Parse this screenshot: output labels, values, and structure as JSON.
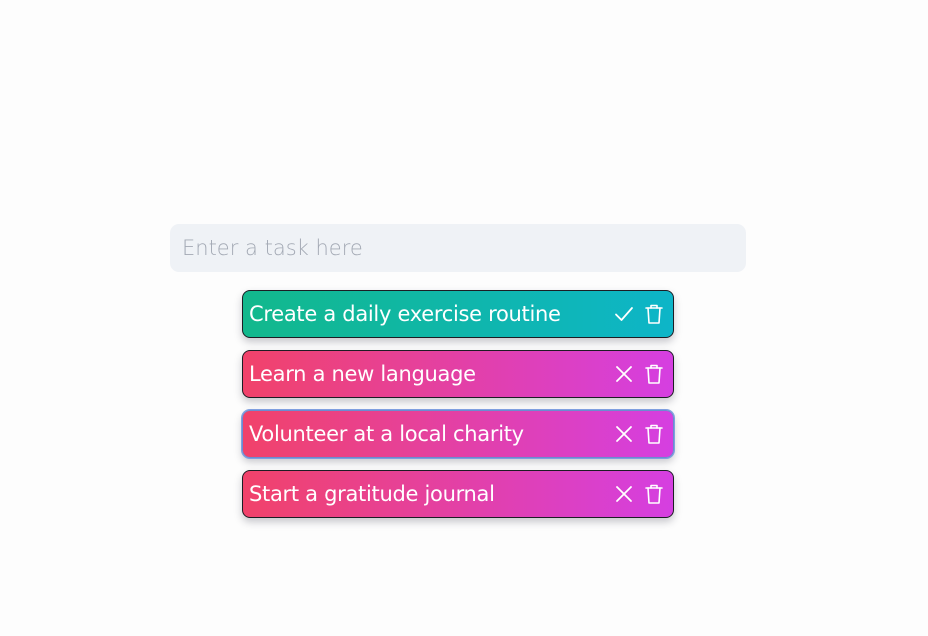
{
  "input": {
    "placeholder": "Enter a task here",
    "value": ""
  },
  "tasks": [
    {
      "text": "Create a daily exercise routine",
      "completed": true,
      "status_icon": "check-icon",
      "delete_icon": "trash-icon"
    },
    {
      "text": "Learn a new language",
      "completed": false,
      "status_icon": "x-icon",
      "delete_icon": "trash-icon"
    },
    {
      "text": "Volunteer at a local charity",
      "completed": false,
      "status_icon": "x-icon",
      "delete_icon": "trash-icon"
    },
    {
      "text": "Start a gratitude journal",
      "completed": false,
      "status_icon": "x-icon",
      "delete_icon": "trash-icon"
    }
  ],
  "colors": {
    "done_gradient_start": "#12b88c",
    "done_gradient_end": "#0db5c8",
    "pending_gradient_start": "#f1426a",
    "pending_gradient_end": "#d53fe1",
    "input_background": "#eff2f6"
  }
}
